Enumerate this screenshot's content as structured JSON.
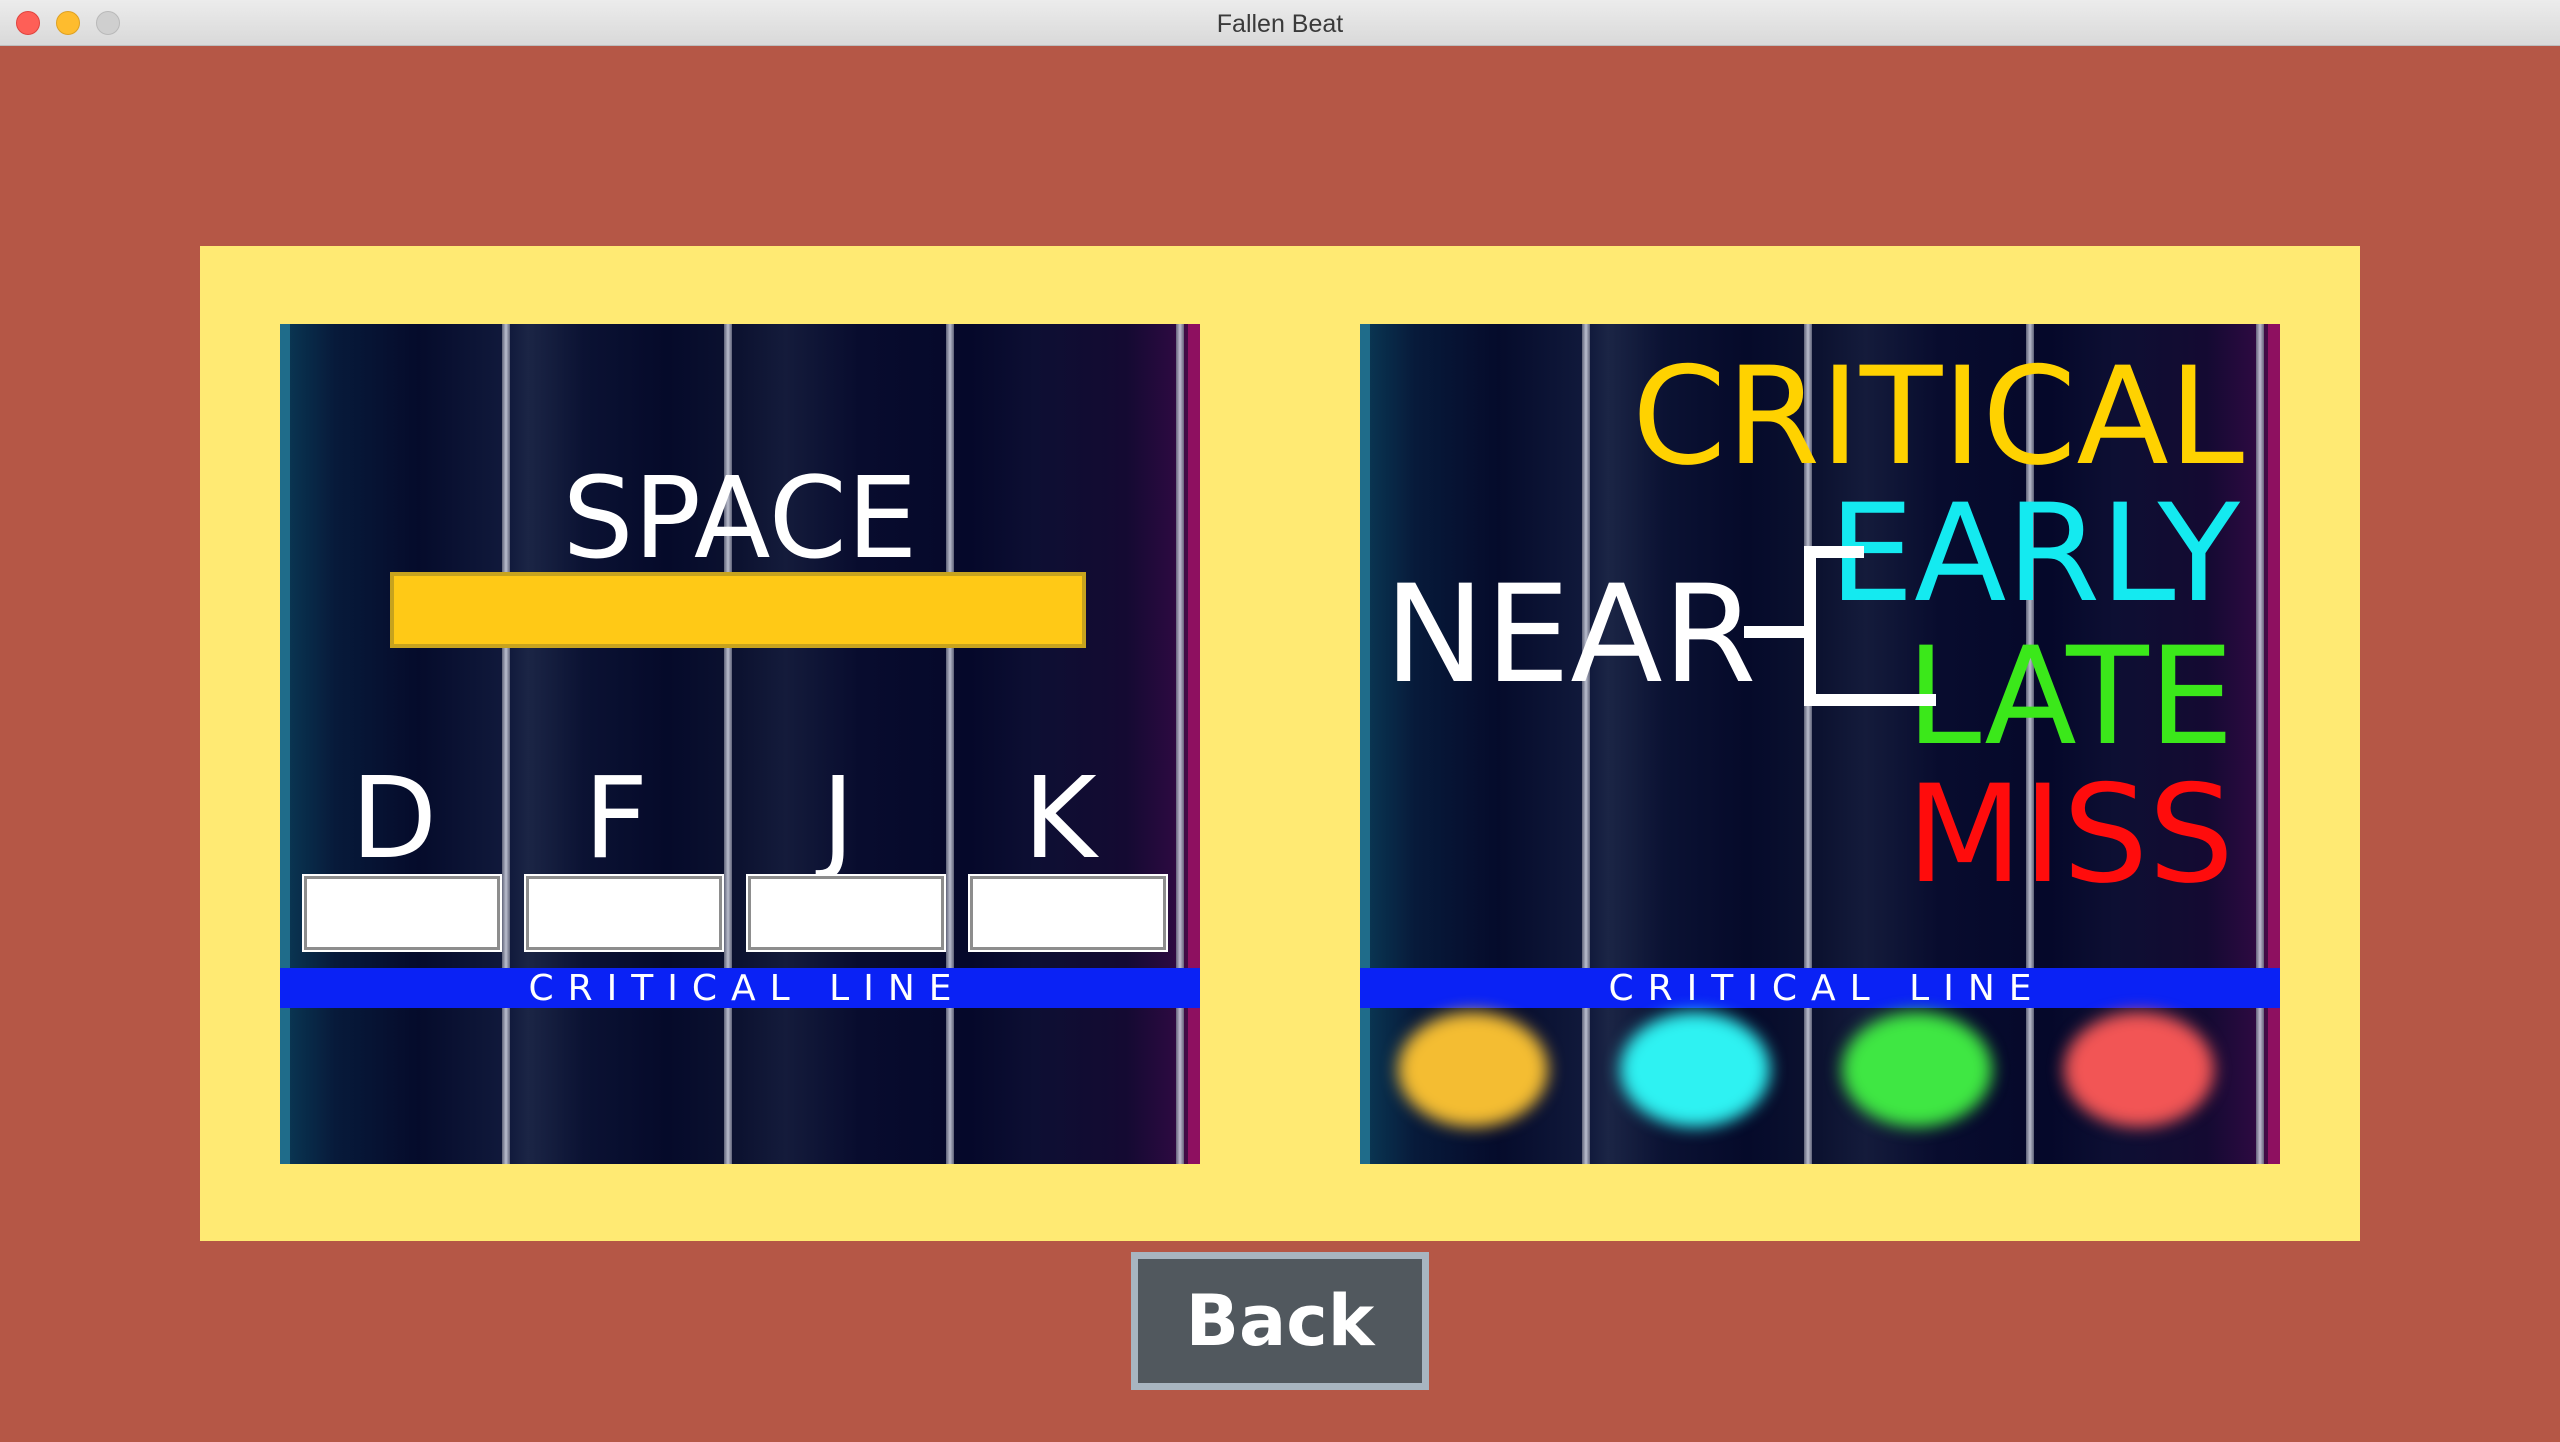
{
  "window": {
    "title": "Fallen Beat"
  },
  "tutorial": {
    "left_panel": {
      "space_key": "SPACE",
      "lane_keys": [
        "D",
        "F",
        "J",
        "K"
      ],
      "critical_line": "CRITICAL LINE"
    },
    "right_panel": {
      "critical": "CRITICAL",
      "near": "NEAR",
      "early": "EARLY",
      "late": "LATE",
      "miss": "MISS",
      "critical_line": "CRITICAL LINE",
      "hit_effects": [
        "critical-yellow",
        "early-cyan",
        "late-green",
        "miss-red"
      ]
    }
  },
  "colors": {
    "background": "#b55746",
    "panel": "#ffea73",
    "critical": "#ffd200",
    "early": "#14eaf0",
    "late": "#3be81a",
    "miss": "#ff0c0c",
    "critical_line": "#0a22f5"
  },
  "buttons": {
    "back": "Back"
  }
}
